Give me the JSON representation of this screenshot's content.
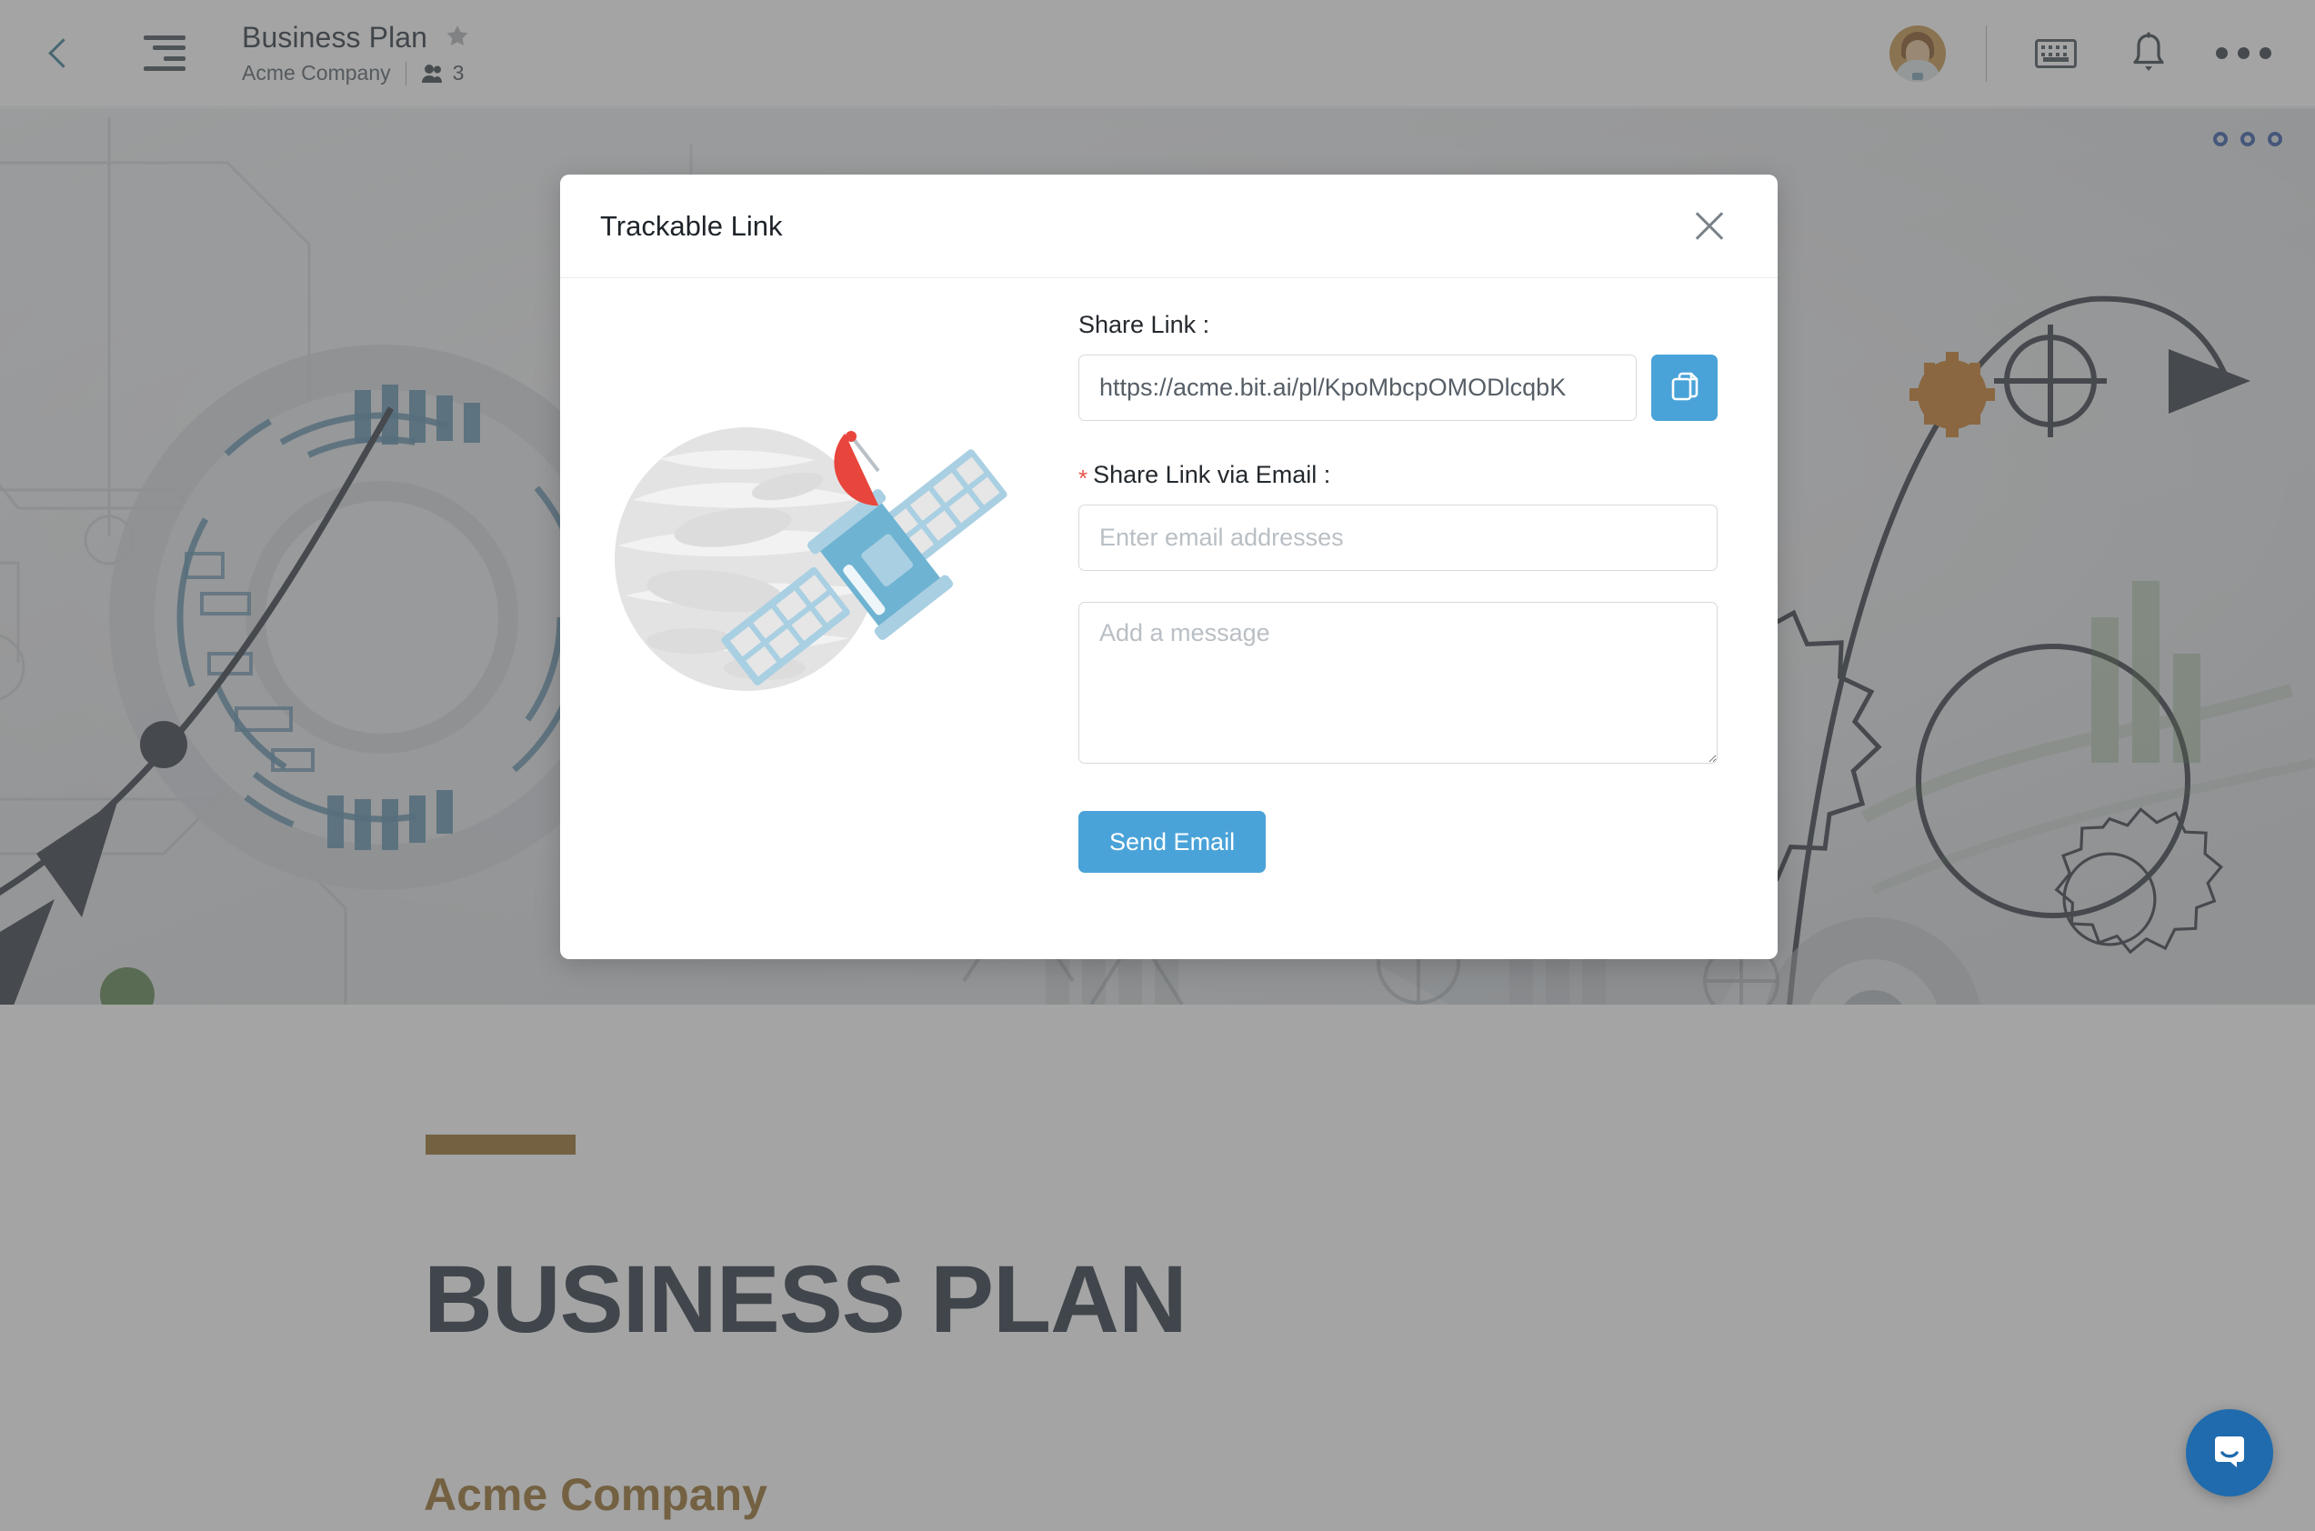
{
  "header": {
    "back_icon": "back-chevron-icon",
    "doc_menu_icon": "document-outline-icon",
    "doc_title": "Business Plan",
    "star_icon": "star-icon",
    "workspace": "Acme Company",
    "member_icon": "members-icon",
    "member_count": "3",
    "avatar_icon": "user-avatar",
    "keyboard_icon": "keyboard-shortcuts-icon",
    "bell_icon": "notifications-bell-icon",
    "more_icon": "more-options-icon"
  },
  "cover": {
    "dots_icon": "cover-options-dots-icon"
  },
  "document": {
    "title": "BUSINESS PLAN",
    "company": "Acme Company"
  },
  "modal": {
    "title": "Trackable Link",
    "close_icon": "close-icon",
    "illustration_icon": "satellite-planet-illustration",
    "share_link_label": "Share Link :",
    "share_link_value": "https://acme.bit.ai/pl/KpoMbcpOMODlcqbK",
    "copy_icon": "copy-icon",
    "email_required_marker": "*",
    "email_label": "Share Link via Email :",
    "email_placeholder": "Enter email addresses",
    "email_value": "",
    "message_placeholder": "Add a message",
    "message_value": "",
    "send_label": "Send Email"
  },
  "widgets": {
    "intercom_icon": "intercom-chat-icon"
  },
  "colors": {
    "accent_blue": "#4aa3d8",
    "required_red": "#e4574c",
    "doc_gold": "#9a7333",
    "doc_navy": "#2f3b48",
    "intercom_blue": "#1f6bad"
  }
}
